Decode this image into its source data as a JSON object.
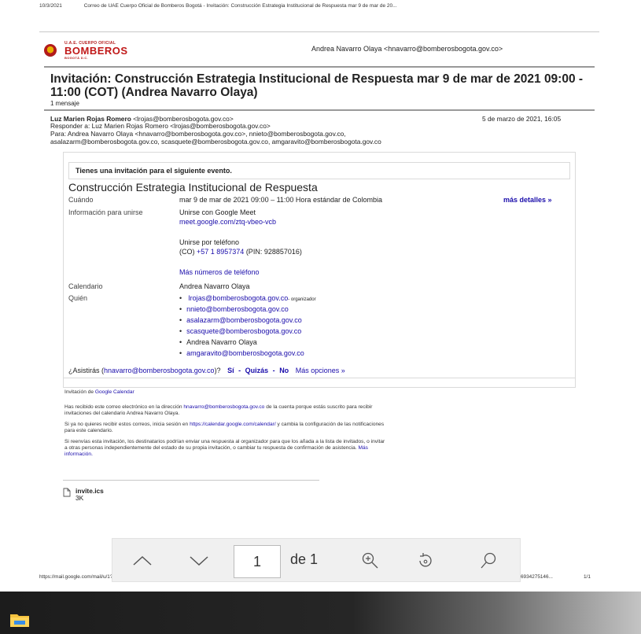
{
  "print_header": {
    "date": "10/3/2021",
    "subject": "Correo de UAE Cuerpo Oficial de Bomberos Bogotá - Invitación: Construcción Estrategia Institucional de Respuesta mar 9 de mar de 20..."
  },
  "logo": {
    "small_text": "U.A.E. CUERPO OFICIAL",
    "brand_text": "BOMBEROS",
    "tag_text": "BOGOTÁ D.C."
  },
  "account": "Andrea Navarro Olaya <hnavarro@bomberosbogota.gov.co>",
  "subject_title": "Invitación: Construcción Estrategia Institucional de Respuesta mar 9 de mar de 2021 09:00 - 11:00 (COT) (Andrea Navarro Olaya)",
  "message_count": "1 mensaje",
  "message": {
    "from": "Luz Marien Rojas Romero",
    "from_email": " <lrojas@bomberosbogota.gov.co>",
    "date": "5 de marzo de 2021, 16:05",
    "reply_to": "Responder a: Luz Marien Rojas Romero <lrojas@bomberosbogota.gov.co>",
    "to_line1": "Para: Andrea Navarro Olaya <hnavarro@bomberosbogota.gov.co>, nnieto@bomberosbogota.gov.co,",
    "to_line2": "asalazarm@bomberosbogota.gov.co, scasquete@bomberosbogota.gov.co, amgaravito@bomberosbogota.gov.co"
  },
  "invite": {
    "banner": "Tienes una invitación para el siguiente evento.",
    "event_title": "Construcción Estrategia Institucional de Respuesta",
    "when_label": "Cuándo",
    "when_value": "mar 9 de mar de 2021 09:00 – 11:00 Hora estándar de Colombia",
    "more_details": "más detalles »",
    "join_label": "Información para unirse",
    "join_meet": "Unirse con Google Meet",
    "meet_link": "meet.google.com/ztq-vbeo-vcb",
    "join_phone": "Unirse por teléfono",
    "phone_prefix": "(CO) ",
    "phone_number": "+57 1 8957374",
    "phone_pin": " (PIN: 928857016)",
    "more_numbers": "Más números de teléfono",
    "calendar_label": "Calendario",
    "calendar_value": "Andrea Navarro Olaya",
    "who_label": "Quién",
    "organizer_email": "lrojas@bomberosbogota.gov.co",
    "organizer_suffix": "- organizador",
    "guests": [
      "nnieto@bomberosbogota.gov.co",
      "asalazarm@bomberosbogota.gov.co",
      "scasquete@bomberosbogota.gov.co",
      "Andrea Navarro Olaya",
      "amgaravito@bomberosbogota.gov.co"
    ],
    "rsvp_question_pre": "¿Asistirás (",
    "rsvp_email": "hnavarro@bomberosbogota.gov.co",
    "rsvp_question_post": ")?",
    "rsvp_yes": "Sí",
    "rsvp_maybe": "Quizás",
    "rsvp_no": "No",
    "rsvp_more": "Más opciones »",
    "rsvp_sep": "-"
  },
  "footer": {
    "invitation_from": "Invitación de ",
    "google_calendar": "Google Calendar",
    "p1_pre": "Has recibido este correo electrónico en la dirección ",
    "p1_email": "hnavarro@bomberosbogota.gov.co",
    "p1_post_line1": " de la cuenta porque estás suscrito para recibir",
    "p1_line2": "invitaciones del calendario Andrea Navarro Olaya.",
    "p2_pre": "Si ya no quieres recibir estos correos, inicia sesión en ",
    "p2_link": "https://calendar.google.com/calendar/",
    "p2_post": " y cambia la configuración de las notificaciones",
    "p2_line2": "para este calendario.",
    "p3_line1": "Si reenvías esta invitación, los destinatarios podrían enviar una respuesta al organizador para que los añada a la lista de invitados, o invitar",
    "p3_line2_pre": "a otras personas independientemente del estado de su propia invitación, o cambiar tu respuesta de confirmación de asistencia. ",
    "p3_more": "Más",
    "p3_more2": "información."
  },
  "attachment": {
    "name": "invite.ics",
    "size": "3K"
  },
  "print_footer": {
    "url": "https://mail.google.com/mail/u/1?ik=5ab9b5b&view=pt&search=all&permmsgid=msg-f%3A1693427514...",
    "tail": "6934275146...",
    "pages": "1/1"
  },
  "toolbar": {
    "page_value": "1",
    "page_total": "de 1",
    "prev_icon": "chevron-up-icon",
    "next_icon": "chevron-down-icon",
    "zoom_icon": "zoom-in-icon",
    "rotate_icon": "rotate-icon",
    "search_icon": "search-icon"
  },
  "taskbar": {
    "pinned": [
      "file-explorer-icon"
    ]
  }
}
